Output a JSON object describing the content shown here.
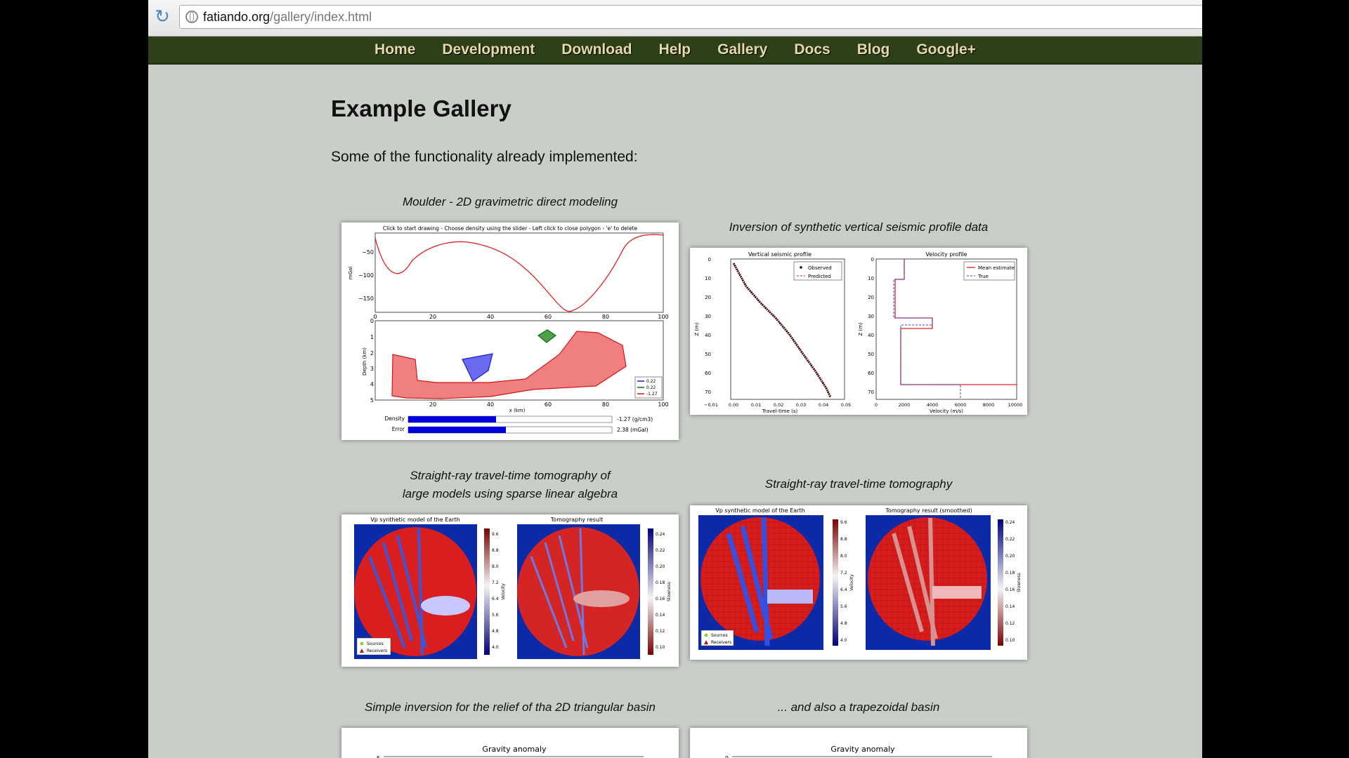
{
  "browser": {
    "url_host": "fatiando.org",
    "url_path": "/gallery/index.html"
  },
  "nav": {
    "items": [
      "Home",
      "Development",
      "Download",
      "Help",
      "Gallery",
      "Docs",
      "Blog",
      "Google+"
    ]
  },
  "page": {
    "title": "Example Gallery",
    "intro": "Some of the functionality already implemented:"
  },
  "figures": [
    {
      "caption": "Moulder - 2D gravimetric direct modeling",
      "header": "Click to start drawing - Choose density using the slider - Left click to close polygon - 'e' to delete",
      "top_ylabel": "mGal",
      "bottom_ylabel": "Depth (km)",
      "xlabel": "x (km)",
      "top_yticks": [
        "−50",
        "−100",
        "−150"
      ],
      "xticks": [
        "0",
        "20",
        "40",
        "60",
        "80",
        "100"
      ],
      "depth_ticks": [
        "0",
        "1",
        "2",
        "3",
        "4",
        "5"
      ],
      "legend": [
        "0.22",
        "0.22",
        "-1.27"
      ],
      "density_label": "Density",
      "density_value": "-1.27 (g/cm3)",
      "density_fill": 0.43,
      "error_label": "Error",
      "error_value": "2.38 (mGal)",
      "error_fill": 0.48
    },
    {
      "caption": "Inversion of synthetic vertical seismic profile data",
      "left_title": "Vertical seismic profile",
      "right_title": "Velocity profile",
      "left_xlabel": "Travel-time (s)",
      "right_xlabel": "Velocity (m/s)",
      "ylabel": "Z (m)",
      "left_legend": [
        "Observed",
        "Predicted"
      ],
      "right_legend": [
        "Mean estimate",
        "True"
      ],
      "z_ticks": [
        "0",
        "10",
        "20",
        "30",
        "40",
        "50",
        "60",
        "70"
      ],
      "time_ticks": [
        "−0.01",
        "0.00",
        "0.01",
        "0.02",
        "0.03",
        "0.04",
        "0.05"
      ],
      "vel_ticks": [
        "0",
        "2000",
        "4000",
        "6000",
        "8000",
        "10000"
      ]
    },
    {
      "caption_line1": "Straight-ray travel-time tomography of",
      "caption_line2": "large models using sparse linear algebra",
      "left_title": "Vp synthetic model of the Earth",
      "right_title": "Tomography result",
      "velocity_label": "Velocity",
      "slowness_label": "Slowness",
      "velocity_ticks": [
        "9.6",
        "8.8",
        "8.0",
        "7.2",
        "6.4",
        "5.6",
        "4.8",
        "4.0"
      ],
      "slowness_ticks": [
        "0.24",
        "0.22",
        "0.20",
        "0.18",
        "0.16",
        "0.14",
        "0.12",
        "0.10"
      ],
      "legend": [
        "Sources",
        "Receivers"
      ]
    },
    {
      "caption": "Straight-ray travel-time tomography",
      "left_title": "Vp synthetic model of the Earth",
      "right_title": "Tomography result (smoothed)",
      "velocity_label": "Velocity",
      "slowness_label": "Slowness",
      "velocity_ticks": [
        "9.6",
        "8.8",
        "8.0",
        "7.2",
        "6.4",
        "5.6",
        "4.8",
        "4.0"
      ],
      "slowness_ticks": [
        "0.24",
        "0.22",
        "0.20",
        "0.18",
        "0.16",
        "0.14",
        "0.12",
        "0.10"
      ],
      "legend": [
        "Sources",
        "Receivers"
      ]
    },
    {
      "caption": "Simple inversion for the relief of tha 2D triangular basin",
      "title": "Gravity anomaly",
      "first_ytick": "5"
    },
    {
      "caption": "... and also a trapezoidal basin",
      "title": "Gravity anomaly",
      "first_ytick": "0"
    }
  ]
}
